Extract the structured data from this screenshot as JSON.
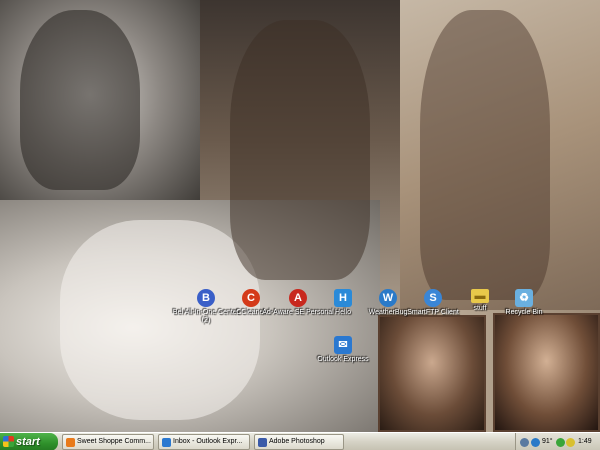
{
  "desktop_icons": [
    {
      "label": "Bel All-In-One Center (2)",
      "icon": "bell-center-icon",
      "color": "#3a5fc8"
    },
    {
      "label": "CCleaner",
      "icon": "ccleaner-icon",
      "color": "#d43a1a"
    },
    {
      "label": "Ad-Aware SE Personal",
      "icon": "ad-aware-icon",
      "color": "#c8281e"
    },
    {
      "label": "Hello",
      "icon": "hello-icon",
      "color": "#2a8ad8"
    },
    {
      "label": "WeatherBug",
      "icon": "weatherbug-icon",
      "color": "#2a7ac8"
    },
    {
      "label": "SmartFTP Client",
      "icon": "smartftp-icon",
      "color": "#3a86d6"
    },
    {
      "label": "stuff",
      "icon": "folder-icon",
      "color": "#e8c84a"
    },
    {
      "label": "Recycle Bin",
      "icon": "recycle-bin-icon",
      "color": "#6ab0e0"
    },
    {
      "label": "Outlook Express",
      "icon": "outlook-express-icon",
      "color": "#2a78d0"
    }
  ],
  "taskbar": {
    "start_label": "start",
    "tasks": [
      {
        "label": "Sweet Shoppe Comm...",
        "icon": "browser-icon",
        "color": "#e87a1a"
      },
      {
        "label": "Inbox - Outlook Expr...",
        "icon": "outlook-express-icon",
        "color": "#2a78d0"
      },
      {
        "label": "Adobe Photoshop",
        "icon": "photoshop-icon",
        "color": "#3a5aa8"
      }
    ],
    "tray": {
      "temperature": "91°",
      "clock": "1:49 PM"
    }
  }
}
